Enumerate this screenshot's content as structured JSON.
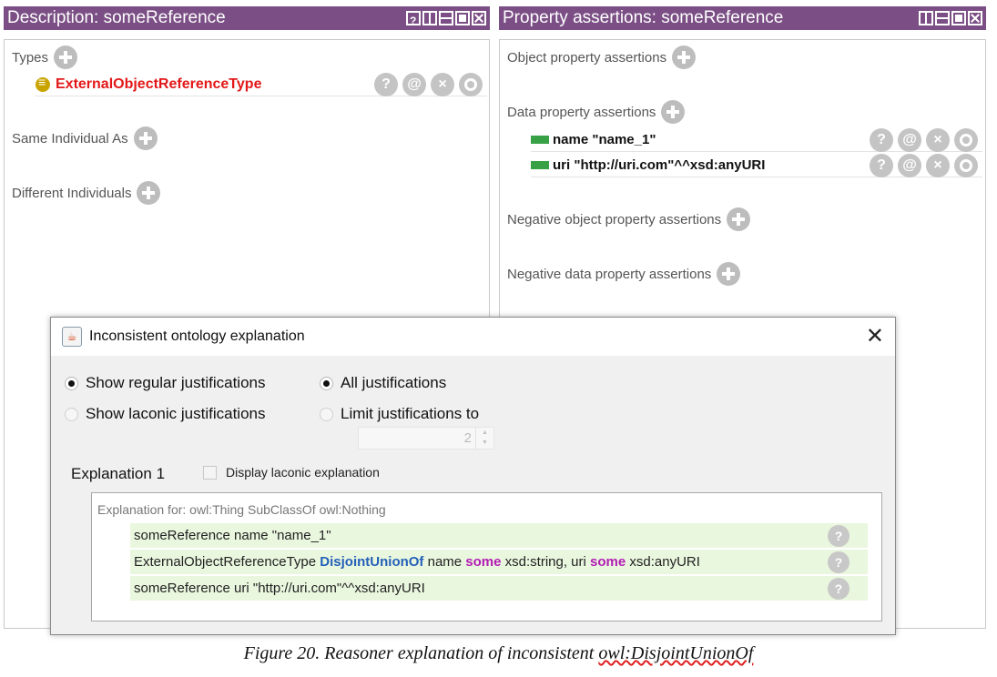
{
  "left_panel": {
    "title": "Description: someReference",
    "sections": {
      "types": "Types",
      "same_individual": "Same Individual As",
      "different_individuals": "Different Individuals"
    },
    "type_item": "ExternalObjectReferenceType"
  },
  "right_panel": {
    "title": "Property assertions: someReference",
    "sections": {
      "object_props": "Object property assertions",
      "data_props": "Data property assertions",
      "neg_object_props": "Negative object property assertions",
      "neg_data_props": "Negative data property assertions"
    },
    "data_assertions": [
      "name  \"name_1\"",
      "uri  \"http://uri.com\"^^xsd:anyURI"
    ]
  },
  "action_buttons": {
    "help": "?",
    "annotate": "@",
    "delete": "×"
  },
  "dialog": {
    "title": "Inconsistent ontology explanation",
    "close": "✕",
    "radios": {
      "regular": "Show regular justifications",
      "laconic": "Show laconic justifications",
      "all": "All justifications",
      "limit": "Limit justifications to"
    },
    "limit_value": "2",
    "explanation_label": "Explanation 1",
    "display_laconic": "Display laconic explanation",
    "explanation_for": "Explanation for: owl:Thing SubClassOf owl:Nothing",
    "axioms": {
      "a1": "someReference name \"name_1\"",
      "a2_part1": "ExternalObjectReferenceType ",
      "a2_kw1": "DisjointUnionOf",
      "a2_part2": " name ",
      "a2_kw2": "some",
      "a2_part3": " xsd:string, uri ",
      "a2_kw3": "some",
      "a2_part4": " xsd:anyURI",
      "a3": "someReference uri \"http://uri.com\"^^xsd:anyURI"
    }
  },
  "caption": {
    "prefix": "Figure 20. Reasoner explanation of inconsistent ",
    "underlined": "owl:DisjointUnionOf"
  },
  "colors": {
    "header": "#7b4f85",
    "type_red": "#e31818",
    "data_green": "#38a045",
    "axiom_bg": "#eaf7df",
    "keyword_blue": "#2460b8",
    "keyword_purple": "#b21cb3"
  }
}
